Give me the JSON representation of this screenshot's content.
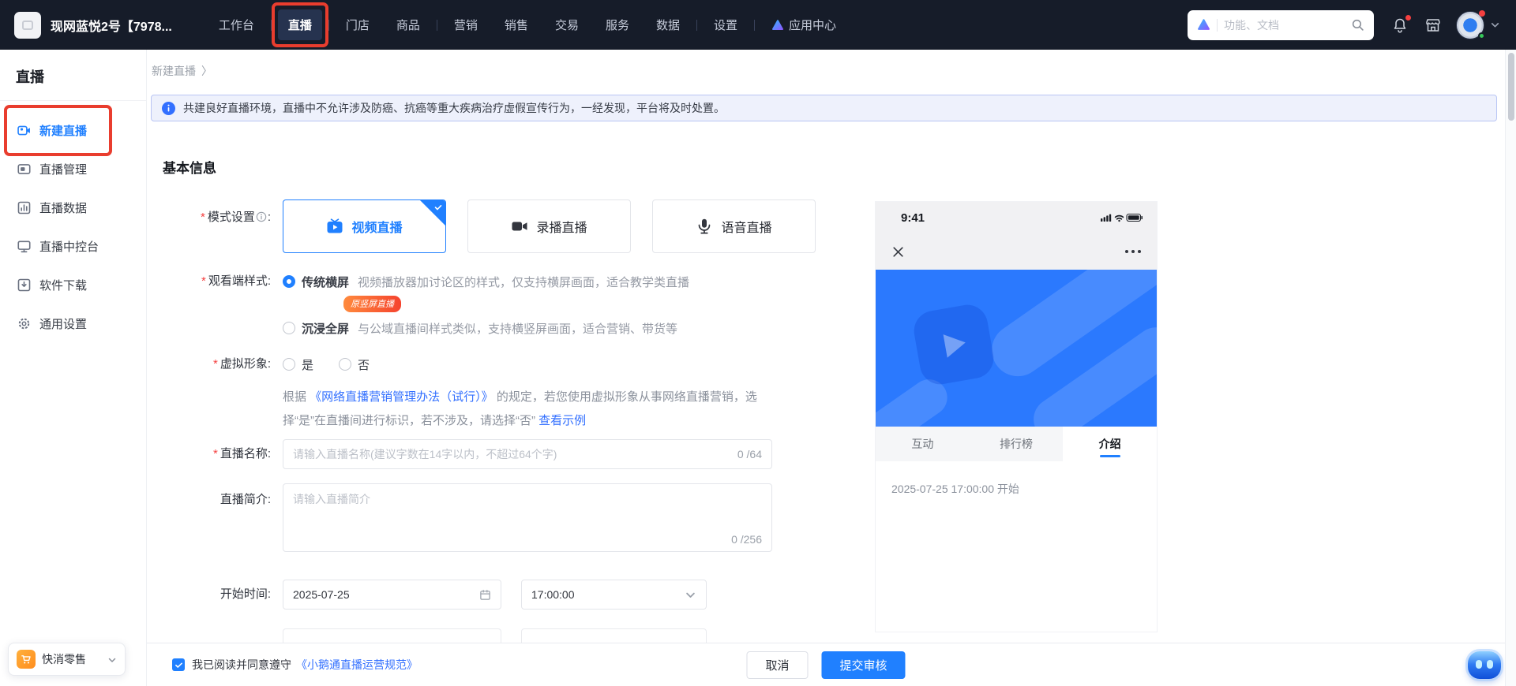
{
  "colors": {
    "accent": "#2080ff",
    "annotation_red": "#e93d2e",
    "navbar_bg": "#161c29",
    "link_blue": "#3370ff",
    "badge_gradient": [
      "#ff8a3d",
      "#f5432e"
    ]
  },
  "navbar": {
    "store_name": "现网蓝悦2号【7978...",
    "items": [
      {
        "label": "工作台"
      },
      {
        "label": "直播",
        "active": true,
        "divider_before": true
      },
      {
        "label": "门店",
        "divider_before": true
      },
      {
        "label": "商品"
      },
      {
        "label": "营销",
        "divider_before": true
      },
      {
        "label": "销售"
      },
      {
        "label": "交易"
      },
      {
        "label": "服务"
      },
      {
        "label": "数据"
      },
      {
        "label": "设置",
        "divider_before": true
      },
      {
        "label": "应用中心",
        "icon": "app-center-icon",
        "divider_before": true
      }
    ],
    "search": {
      "placeholder": "功能、文档"
    }
  },
  "sidebar": {
    "title": "直播",
    "items": [
      {
        "label": "新建直播",
        "icon": "video-camera-icon",
        "active": true
      },
      {
        "label": "直播管理",
        "icon": "live-manage-icon"
      },
      {
        "label": "直播数据",
        "icon": "bar-chart-icon"
      },
      {
        "label": "直播中控台",
        "icon": "console-icon"
      },
      {
        "label": "软件下载",
        "icon": "download-icon"
      },
      {
        "label": "通用设置",
        "icon": "gear-icon"
      }
    ],
    "workspace": {
      "label": "快消零售",
      "icon": "cart-icon"
    }
  },
  "breadcrumb": {
    "current": "新建直播",
    "separator": "〉"
  },
  "notice": "共建良好直播环境，直播中不允许涉及防癌、抗癌等重大疾病治疗虚假宣传行为，一经发现，平台将及时处置。",
  "form": {
    "section_title": "基本信息",
    "mode": {
      "label": "模式设置",
      "colon": ":",
      "options": [
        {
          "label": "视频直播",
          "icon": "tv-play-icon",
          "active": true
        },
        {
          "label": "录播直播",
          "icon": "camcorder-icon"
        },
        {
          "label": "语音直播",
          "icon": "mic-icon"
        }
      ]
    },
    "view_style": {
      "label": "观看端样式:",
      "options": [
        {
          "name": "传统横屏",
          "desc": "视频播放器加讨论区的样式，仅支持横屏画面，适合教学类直播",
          "badge": "原竖屏直播",
          "active": true
        },
        {
          "name": "沉浸全屏",
          "desc": "与公域直播间样式类似，支持横竖屏画面，适合营销、带货等"
        }
      ]
    },
    "virtual": {
      "label": "虚拟形象:",
      "yes": "是",
      "no": "否",
      "help_prefix": "根据 ",
      "help_link": "《网络直播营销管理办法（试行）》",
      "help_suffix": " 的规定，若您使用虚拟形象从事网络直播营销，选择“是”在直播间进行标识，若不涉及，请选择“否” ",
      "example_link": "查看示例"
    },
    "name": {
      "label": "直播名称:",
      "placeholder": "请输入直播名称(建议字数在14字以内，不超过64个字)",
      "counter": "0 /64"
    },
    "intro": {
      "label": "直播简介:",
      "placeholder": "请输入直播简介",
      "counter": "0 /256"
    },
    "start": {
      "label": "开始时间:",
      "date": "2025-07-25",
      "time": "17:00:00"
    }
  },
  "preview": {
    "clock": "9:41",
    "tabs": [
      {
        "label": "互动"
      },
      {
        "label": "排行榜"
      },
      {
        "label": "介绍",
        "active": true
      }
    ],
    "start_text": "2025-07-25 17:00:00 开始"
  },
  "footer": {
    "agree_text": "我已阅读并同意遵守",
    "agree_link": "《小鹅通直播运营规范》",
    "cancel": "取消",
    "submit": "提交审核"
  }
}
